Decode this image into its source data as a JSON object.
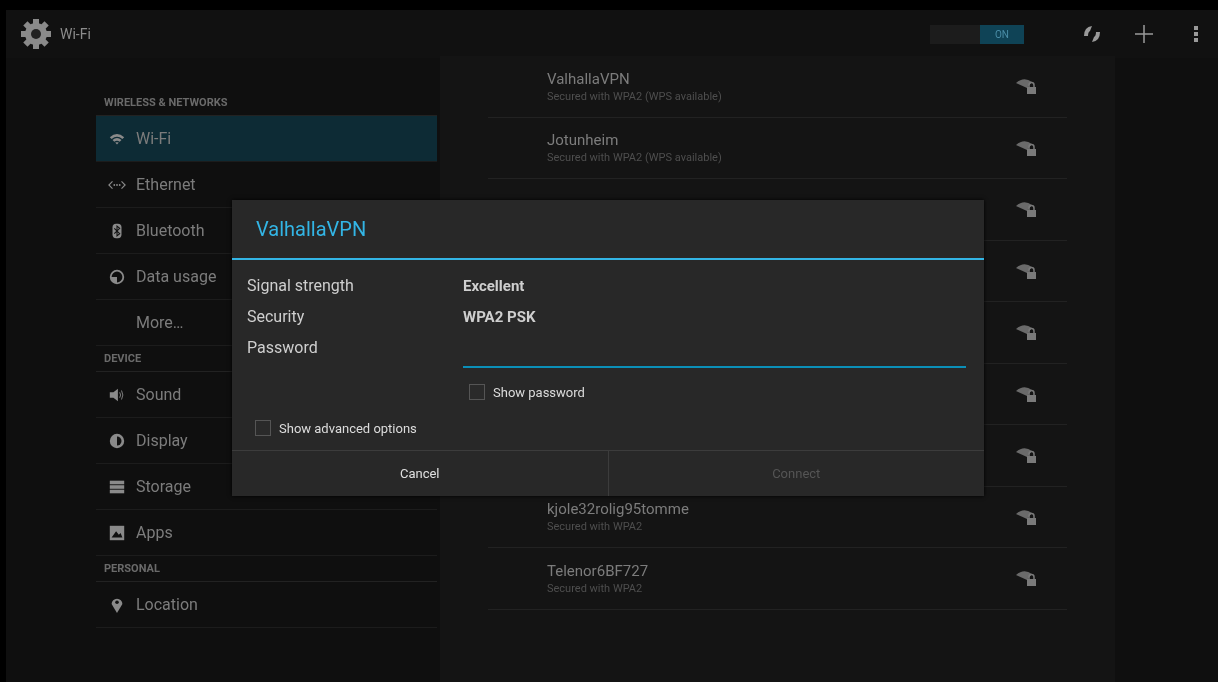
{
  "action_bar": {
    "title": "Wi-Fi",
    "toggle": {
      "label": "ON",
      "on": true
    }
  },
  "sidebar": [
    {
      "kind": "header",
      "label": "WIRELESS & NETWORKS"
    },
    {
      "kind": "item",
      "label": "Wi-Fi",
      "selected": true
    },
    {
      "kind": "item",
      "label": "Ethernet",
      "selected": false
    },
    {
      "kind": "item",
      "label": "Bluetooth",
      "selected": false
    },
    {
      "kind": "item",
      "label": "Data usage",
      "selected": false
    },
    {
      "kind": "item",
      "label": "More…",
      "selected": false
    },
    {
      "kind": "header",
      "label": "DEVICE"
    },
    {
      "kind": "item",
      "label": "Sound",
      "selected": false
    },
    {
      "kind": "item",
      "label": "Display",
      "selected": false
    },
    {
      "kind": "item",
      "label": "Storage",
      "selected": false
    },
    {
      "kind": "item",
      "label": "Apps",
      "selected": false
    },
    {
      "kind": "header",
      "label": "PERSONAL"
    },
    {
      "kind": "item",
      "label": "Location",
      "selected": false
    }
  ],
  "networks": [
    {
      "name": "ValhallaVPN",
      "security": "Secured with WPA2 (WPS available)",
      "secured": true
    },
    {
      "name": "Jotunheim",
      "security": "Secured with WPA2 (WPS available)",
      "secured": true
    },
    {
      "secured": true
    },
    {
      "secured": true
    },
    {
      "secured": true
    },
    {
      "secured": true
    },
    {
      "secured": true
    },
    {
      "name": "kjole32rolig95tomme",
      "security": "Secured with WPA2",
      "secured": true
    },
    {
      "name": "Telenor6BF727",
      "security": "Secured with WPA2",
      "secured": true
    }
  ],
  "dialog": {
    "title": "ValhallaVPN",
    "fields": [
      {
        "label": "Signal strength",
        "value": "Excellent"
      },
      {
        "label": "Security",
        "value": "WPA2 PSK"
      }
    ],
    "password": {
      "label": "Password"
    },
    "show_password": {
      "label": "Show password",
      "checked": false
    },
    "advanced": {
      "label": "Show advanced options",
      "checked": false
    },
    "buttons": [
      {
        "label": "Cancel",
        "disabled": false
      },
      {
        "label": "Connect",
        "disabled": true
      }
    ]
  }
}
